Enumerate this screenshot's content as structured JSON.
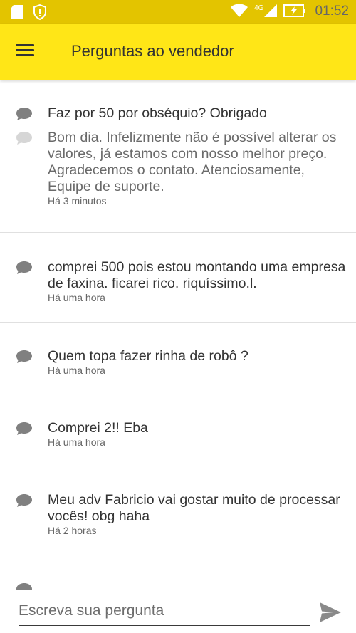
{
  "status_bar": {
    "network": "4G",
    "time": "01:52"
  },
  "app_bar": {
    "title": "Perguntas ao vendedor"
  },
  "questions": [
    {
      "question": "Faz por 50 por obséquio? Obrigado",
      "answer": "Bom dia. Infelizmente não é possível alterar os valores, já estamos com nosso melhor preço. Agradecemos o contato. Atenciosamente, Equipe de suporte.",
      "time": "Há 3 minutos"
    },
    {
      "question": "comprei 500 pois estou montando uma empresa de faxina. ficarei rico. riquíssimo.l.",
      "time": "Há uma hora"
    },
    {
      "question": "Quem topa fazer rinha de robô ?",
      "time": "Há uma hora"
    },
    {
      "question": "Comprei 2!! Eba",
      "time": "Há uma hora"
    },
    {
      "question": "Meu adv Fabricio vai gostar muito de processar vocês! obg haha",
      "time": "Há 2 horas"
    },
    {
      "question": "..........",
      "time": ""
    }
  ],
  "composer": {
    "placeholder": "Escreva sua pergunta"
  },
  "colors": {
    "status_bar": "#e3c400",
    "app_bar": "#ffe617",
    "bubble_question": "#808080",
    "bubble_answer": "#d6d6d6",
    "send_icon": "#8a8a8a"
  },
  "icons": {
    "status_left": [
      "sd-card-icon",
      "alert-shield-icon"
    ],
    "status_right": [
      "wifi-icon",
      "signal-icon",
      "battery-charging-icon"
    ],
    "menu": "hamburger-menu-icon",
    "question": "chat-bubble-icon",
    "answer": "chat-bubble-icon",
    "send": "send-arrow-icon"
  }
}
